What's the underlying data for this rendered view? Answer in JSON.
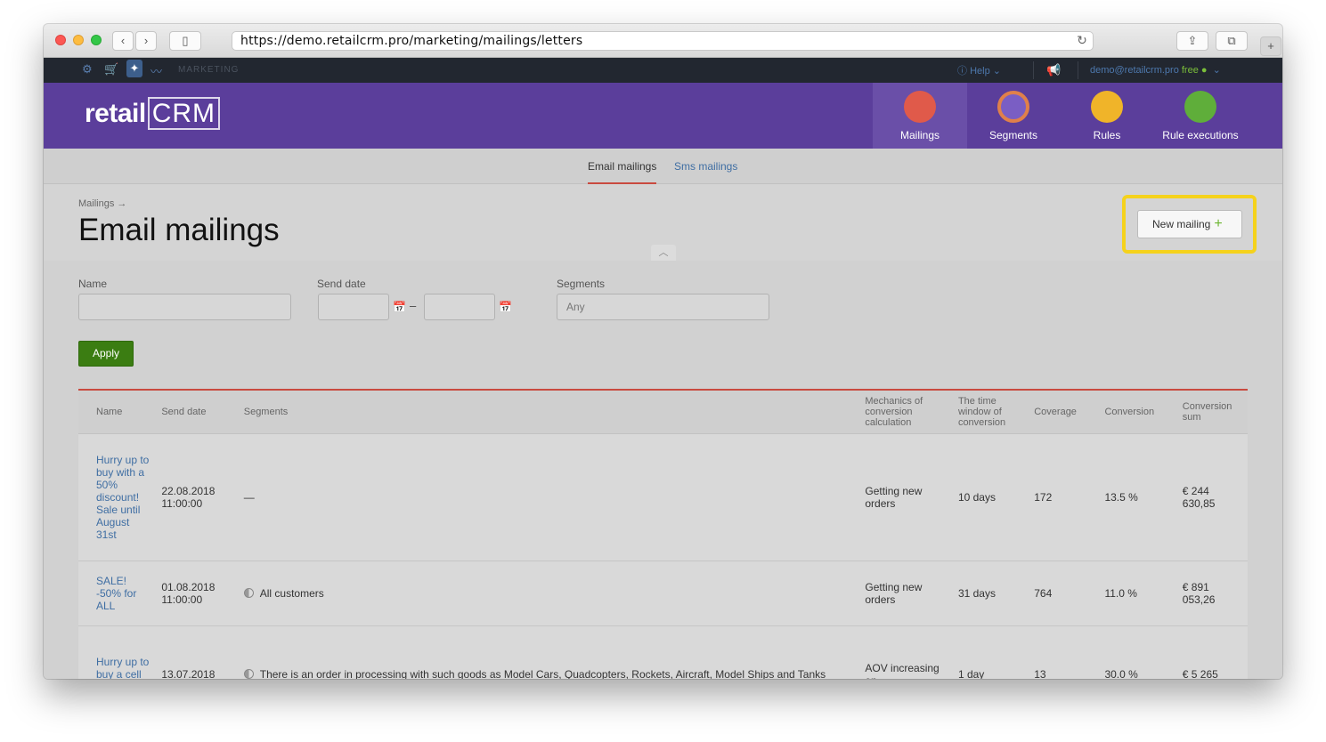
{
  "browser": {
    "url": "https://demo.retailcrm.pro/marketing/mailings/letters"
  },
  "topbar": {
    "section": "MARKETING",
    "help": "Help",
    "user_email": "demo@retailcrm.pro",
    "plan": "free"
  },
  "header": {
    "logo_main": "retail",
    "logo_crm": "CRM",
    "tabs": [
      {
        "label": "Mailings",
        "color": "#e05a4a"
      },
      {
        "label": "Segments",
        "color": "#7a5ec4"
      },
      {
        "label": "Rules",
        "color": "#f0b429"
      },
      {
        "label": "Rule executions",
        "color": "#5fae3a"
      }
    ]
  },
  "subnav": {
    "email": "Email mailings",
    "sms": "Sms mailings"
  },
  "page": {
    "breadcrumb": "Mailings →",
    "title": "Email mailings",
    "new_button": "New mailing"
  },
  "filters": {
    "name_label": "Name",
    "send_date_label": "Send date",
    "segments_label": "Segments",
    "segments_placeholder": "Any",
    "apply": "Apply"
  },
  "table": {
    "headers": [
      "Name",
      "Send date",
      "Segments",
      "Mechanics of conversion calculation",
      "The time window of conversion",
      "Coverage",
      "Conversion",
      "Conversion sum"
    ],
    "rows": [
      {
        "name": "Hurry up to buy with a 50% discount! Sale until August 31st",
        "send_date": "22.08.2018 11:00:00",
        "segments": "—",
        "mechanics": "Getting new orders",
        "window": "10 days",
        "coverage": "172",
        "conversion": "13.5 %",
        "sum": "€ 244 630,85"
      },
      {
        "name": "SALE! -50% for ALL",
        "send_date": "01.08.2018 11:00:00",
        "segments": "All customers",
        "mechanics": "Getting new orders",
        "window": "31 days",
        "coverage": "764",
        "conversion": "11.0 %",
        "sum": "€ 891 053,26"
      },
      {
        "name": "Hurry up to buy a cell phone",
        "send_date": "13.07.2018",
        "segments": "There is an order in processing with such goods as Model Cars, Quadcopters, Rockets, Aircraft, Model Ships and Tanks",
        "mechanics": "AOV increasing on",
        "window": "1 day",
        "coverage": "13",
        "conversion": "30.0 %",
        "sum": "€ 5 265"
      }
    ]
  }
}
